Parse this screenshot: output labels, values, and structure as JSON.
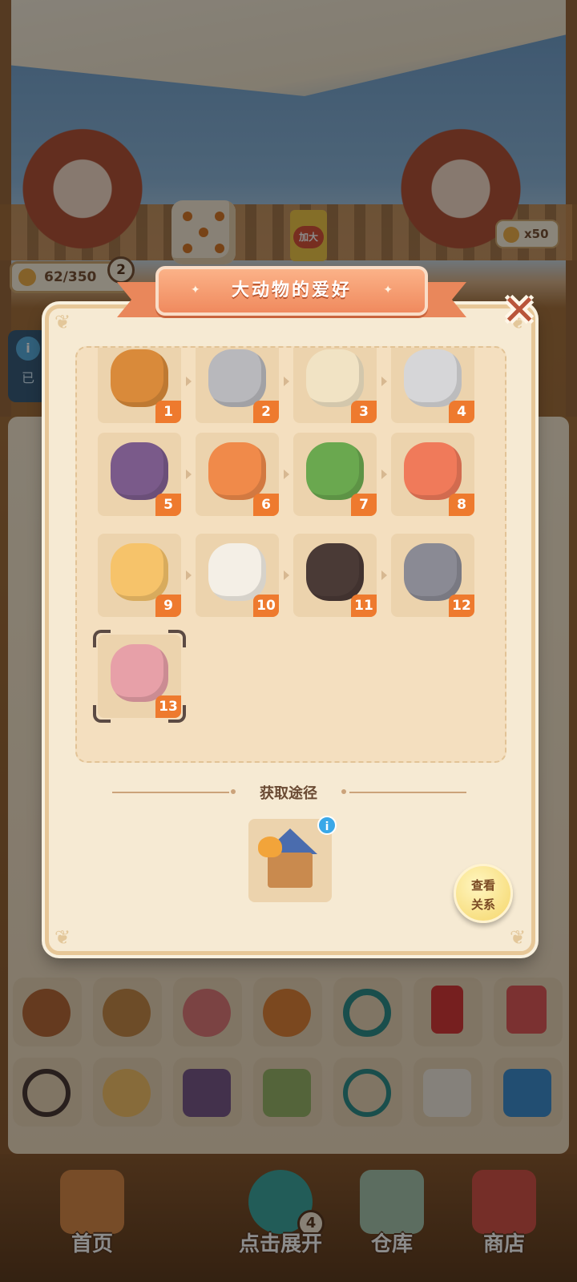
{
  "status_bar": {
    "paw_counter": "62/350",
    "level_badge": "2",
    "paw_counter_right": "x50",
    "info_text": "已"
  },
  "scene_items": {
    "heart_card_text": "加大"
  },
  "dialog": {
    "title": "大动物的爱好",
    "close_label": "✕",
    "chain": [
      {
        "num": "1",
        "icon": "snack-basket-icon",
        "color": "#d98a3a"
      },
      {
        "num": "2",
        "icon": "raccoon-keychain-icon",
        "color": "#b8b8bc"
      },
      {
        "num": "3",
        "icon": "go-board-icon",
        "color": "#f1e3c4"
      },
      {
        "num": "4",
        "icon": "cat-keychain-icon",
        "color": "#d6d6d8"
      },
      {
        "num": "5",
        "icon": "night-book-icon",
        "color": "#7a5a8a"
      },
      {
        "num": "6",
        "icon": "fox-keychain-icon",
        "color": "#f08a4a"
      },
      {
        "num": "7",
        "icon": "takoyaki-tray-icon",
        "color": "#6aa84f"
      },
      {
        "num": "8",
        "icon": "octopus-keychain-icon",
        "color": "#f07a5a"
      },
      {
        "num": "9",
        "icon": "rainbow-wings-icon",
        "color": "#f6c36a"
      },
      {
        "num": "10",
        "icon": "dog-keychain-icon",
        "color": "#f4efe6"
      },
      {
        "num": "11",
        "icon": "infinity-bracelet-icon",
        "color": "#4a3a36"
      },
      {
        "num": "12",
        "icon": "gray-cat-keychain-icon",
        "color": "#8a8a94"
      },
      {
        "num": "13",
        "icon": "girl-portrait-keychain-icon",
        "color": "#e7a0a8"
      }
    ],
    "section_title": "获取途径",
    "source_icon": "cat-house-icon",
    "source_info": "i",
    "relation_button": "查看关系",
    "relation_line1": "查看",
    "relation_line2": "关系"
  },
  "nav": {
    "home": "首页",
    "expand": "点击展开",
    "expand_badge": "4",
    "warehouse": "仓库",
    "shop": "商店"
  }
}
